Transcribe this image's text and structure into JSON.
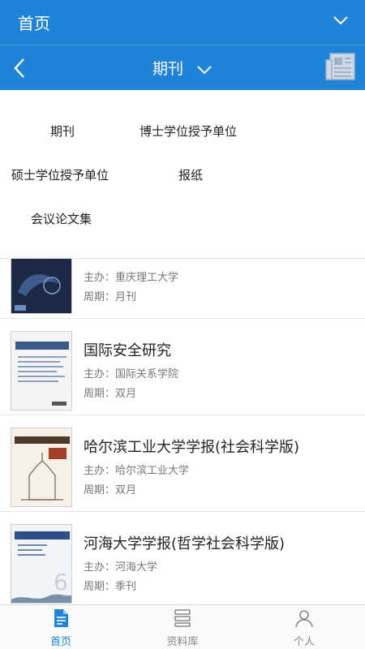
{
  "header": {
    "title": "首页",
    "menu_icon": "chevron-down-icon"
  },
  "subheader": {
    "title": "期刊",
    "back_icon": "back-arrow-icon",
    "toggle_icon": "chevron-down-icon",
    "view_icon": "newspaper-list-icon"
  },
  "dropdown": {
    "options": [
      "期刊",
      "博士学位授予单位",
      "硕士学位授予单位",
      "报纸",
      "会议论文集"
    ]
  },
  "journals": [
    {
      "name": "",
      "host": "主办：重庆理工大学",
      "period": "周期：月刊"
    },
    {
      "name": "国际安全研究",
      "host": "主办：国际关系学院",
      "period": "周期：双月"
    },
    {
      "name": "哈尔滨工业大学学报(社会科学版)",
      "host": "主办：哈尔滨工业大学",
      "period": "周期：双月"
    },
    {
      "name": "河海大学学报(哲学社会科学版)",
      "host": "主办：河海大学",
      "period": "周期：季刊"
    }
  ],
  "tabs": [
    {
      "label": "首页",
      "icon": "document-icon"
    },
    {
      "label": "资料库",
      "icon": "database-icon"
    },
    {
      "label": "个人",
      "icon": "user-icon"
    }
  ],
  "colors": {
    "primary": "#1f83d8",
    "text": "#222222",
    "muted": "#777777"
  }
}
